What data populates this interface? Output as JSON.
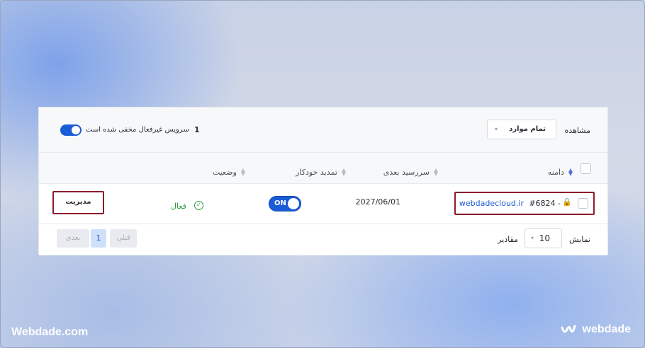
{
  "toolbar": {
    "view_label": "مشاهده",
    "filter_value": "تمام موارد",
    "hidden_count": "1",
    "hidden_text": "سرویس غیرفعال مخفی شده است"
  },
  "table": {
    "columns": {
      "domain": "دامنه",
      "next_due": "سررسید بعدی",
      "auto_renew": "تمدید خودکار",
      "status": "وضعیت"
    },
    "rows": [
      {
        "domain": "webdadecloud.ir",
        "id": "#6824 -",
        "next_due": "2027/06/01",
        "auto_renew_label": "ON",
        "status": "فعال",
        "manage_label": "مدیریت"
      }
    ]
  },
  "footer": {
    "show_label": "نمایش",
    "page_size": "10",
    "values_label": "مقادیر",
    "prev_label": "قبلی",
    "current_page": "1",
    "next_label": "بعدی"
  },
  "branding": {
    "left": "Webdade.com",
    "right": "webdade"
  },
  "colors": {
    "accent": "#1a5bd6",
    "active_status": "#2e9e3f",
    "highlight_border": "#8b1c2b",
    "link": "#1a5bd6"
  }
}
